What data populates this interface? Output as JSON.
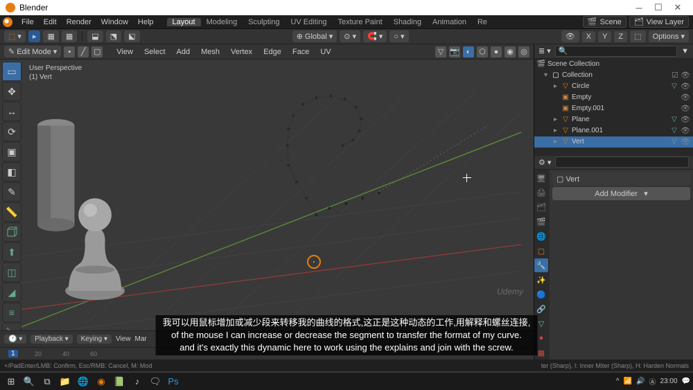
{
  "window": {
    "title": "Blender"
  },
  "menubar": {
    "items": [
      "File",
      "Edit",
      "Render",
      "Window",
      "Help"
    ],
    "tabs": [
      "Layout",
      "Modeling",
      "Sculpting",
      "UV Editing",
      "Texture Paint",
      "Shading",
      "Animation",
      "Re"
    ],
    "active_tab": 0,
    "scene_label": "Scene",
    "viewlayer_label": "View Layer"
  },
  "toolheader": {
    "orientation_label": "Global",
    "options_label": "Options"
  },
  "editbar": {
    "mode_label": "Edit Mode",
    "menus": [
      "View",
      "Select",
      "Add",
      "Mesh",
      "Vertex",
      "Edge",
      "Face",
      "UV"
    ]
  },
  "viewport": {
    "line1": "User Perspective",
    "line2": "(1) Vert"
  },
  "outliner": {
    "root": "Scene Collection",
    "collection": "Collection",
    "items": [
      {
        "name": "Circle",
        "icon": "▽",
        "color": "#e87d0d"
      },
      {
        "name": "Empty",
        "icon": "▣",
        "color": "#cc8844"
      },
      {
        "name": "Empty.001",
        "icon": "▣",
        "color": "#cc8844"
      },
      {
        "name": "Plane",
        "icon": "▽",
        "color": "#e87d0d"
      },
      {
        "name": "Plane.001",
        "icon": "▽",
        "color": "#e87d0d"
      },
      {
        "name": "Vert",
        "icon": "▽",
        "color": "#e87d0d",
        "selected": true
      }
    ]
  },
  "properties": {
    "obj_name": "Vert",
    "add_modifier_label": "Add Modifier"
  },
  "timeline": {
    "playback": "Playback",
    "keying": "Keying",
    "view": "View",
    "marker": "Mar",
    "current": 1,
    "ticks": [
      20,
      40,
      60
    ]
  },
  "statusbar": {
    "left": "+/PadEnter/LMB: Confirm, Esc/RMB: Cancel, M: Mod",
    "right": "ter (Sharp), I: Inner Miter (Sharp), H: Harden Normals"
  },
  "subtitle": {
    "l1": "我可以用鼠标增加或减少段来转移我的曲线的格式,这正是这种动态的工作,用解释和螺丝连接,",
    "l2": "of the mouse I can increase or decrease the segment to transfer the format of my curve.",
    "l3": "and it's exactly this dynamic here to work using the explains and join with the screw."
  },
  "taskbar": {
    "time": "23:00"
  },
  "watermark": "Udemy"
}
